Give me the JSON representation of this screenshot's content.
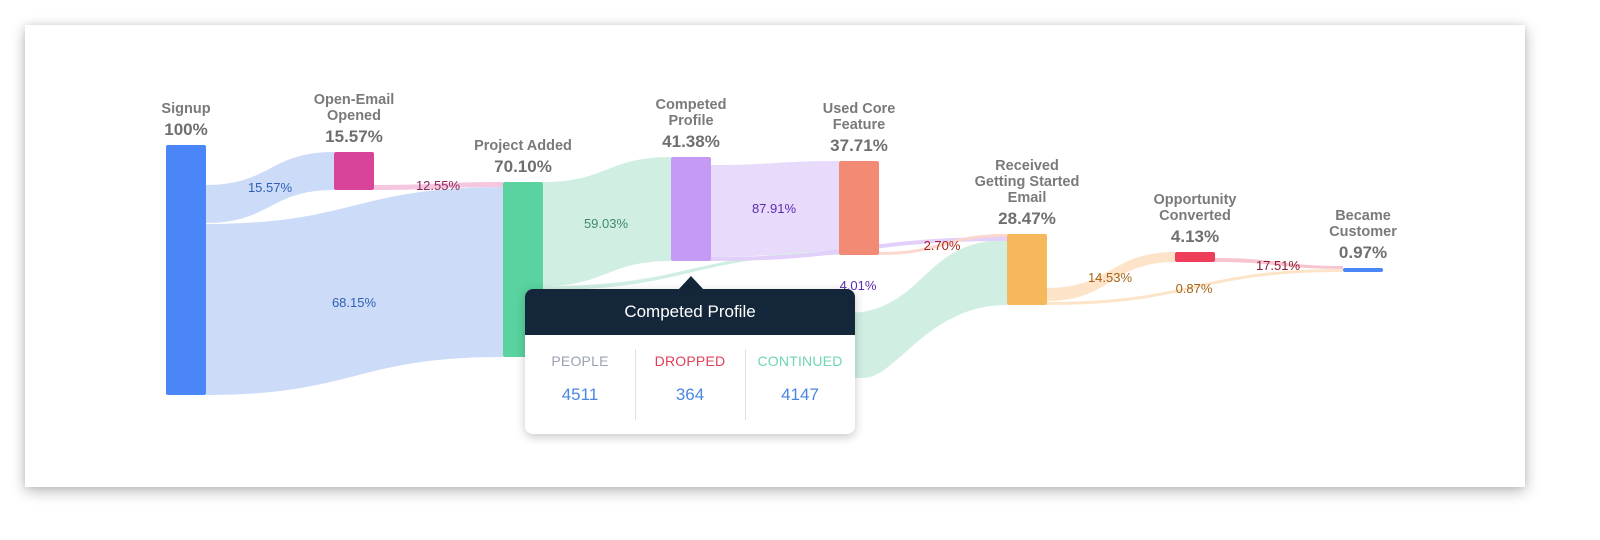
{
  "chart_data": {
    "type": "sankey",
    "title": "",
    "nodes": [
      {
        "id": "signup",
        "title_lines": [
          "Signup"
        ],
        "percent": 100,
        "value_label": "100%",
        "color": "#4a86f7"
      },
      {
        "id": "open_email",
        "title_lines": [
          "Open-Email",
          "Opened"
        ],
        "percent": 15.57,
        "value_label": "15.57%",
        "color": "#d9449a"
      },
      {
        "id": "project_added",
        "title_lines": [
          "Project Added"
        ],
        "percent": 70.1,
        "value_label": "70.10%",
        "color": "#5ad3a0"
      },
      {
        "id": "competed_profile",
        "title_lines": [
          "Competed",
          "Profile"
        ],
        "percent": 41.38,
        "value_label": "41.38%",
        "color": "#c59af5"
      },
      {
        "id": "used_core_feature",
        "title_lines": [
          "Used Core",
          "Feature"
        ],
        "percent": 37.71,
        "value_label": "37.71%",
        "color": "#f28a74"
      },
      {
        "id": "received_email",
        "title_lines": [
          "Received",
          "Getting Started",
          "Email"
        ],
        "percent": 28.47,
        "value_label": "28.47%",
        "color": "#f5b85a"
      },
      {
        "id": "opportunity_converted",
        "title_lines": [
          "Opportunity",
          "Converted"
        ],
        "percent": 4.13,
        "value_label": "4.13%",
        "color": "#ef3e5a"
      },
      {
        "id": "became_customer",
        "title_lines": [
          "Became",
          "Customer"
        ],
        "percent": 0.97,
        "value_label": "0.97%",
        "color": "#4a86f7"
      }
    ],
    "links": [
      {
        "source": "signup",
        "target": "open_email",
        "percent": 15.57,
        "label": "15.57%",
        "color": "#c9d9f8",
        "label_color": "#2f5fb3"
      },
      {
        "source": "signup",
        "target": "project_added",
        "percent": 68.15,
        "label": "68.15%",
        "color": "#c9d9f8",
        "label_color": "#2f5fb3"
      },
      {
        "source": "open_email",
        "target": "project_added",
        "percent": 12.55,
        "label": "12.55%",
        "color": "#f3c4dd",
        "label_color": "#8a2a5e"
      },
      {
        "source": "project_added",
        "target": "competed_profile",
        "percent": 59.03,
        "label": "59.03%",
        "color": "#cdeee0",
        "label_color": "#3f8a6a"
      },
      {
        "source": "project_added",
        "target": "used_core_feature",
        "percent": null,
        "label": "",
        "color": "#cdeee0",
        "label_color": "#3f8a6a"
      },
      {
        "source": "project_added",
        "target": "received_email",
        "percent": null,
        "label": "",
        "color": "#cdeee0",
        "label_color": "#3f8a6a"
      },
      {
        "source": "competed_profile",
        "target": "used_core_feature",
        "percent": 87.91,
        "label": "87.91%",
        "color": "#e6d8fb",
        "label_color": "#5b2bb0"
      },
      {
        "source": "competed_profile",
        "target": "received_email",
        "percent": 4.01,
        "label": "4.01%",
        "color": "#e2cdfa",
        "label_color": "#5b2bb0"
      },
      {
        "source": "used_core_feature",
        "target": "received_email",
        "percent": 2.7,
        "label": "2.70%",
        "color": "#fbd5cc",
        "label_color": "#a8261a"
      },
      {
        "source": "received_email",
        "target": "opportunity_converted",
        "percent": 14.53,
        "label": "14.53%",
        "color": "#fde3c6",
        "label_color": "#a3661a"
      },
      {
        "source": "received_email",
        "target": "became_customer",
        "percent": 0.87,
        "label": "0.87%",
        "color": "#fde3c6",
        "label_color": "#a3661a"
      },
      {
        "source": "opportunity_converted",
        "target": "became_customer",
        "percent": 17.51,
        "label": "17.51%",
        "color": "#f6c2cc",
        "label_color": "#8a1e33"
      }
    ],
    "tooltip": {
      "node": "competed_profile",
      "title": "Competed Profile",
      "stats": [
        {
          "label": "PEOPLE",
          "value": "4511",
          "label_color": "#9aa3b2"
        },
        {
          "label": "DROPPED",
          "value": "364",
          "label_color": "#e0405a"
        },
        {
          "label": "CONTINUED",
          "value": "4147",
          "label_color": "#6fd5b5"
        }
      ]
    }
  }
}
